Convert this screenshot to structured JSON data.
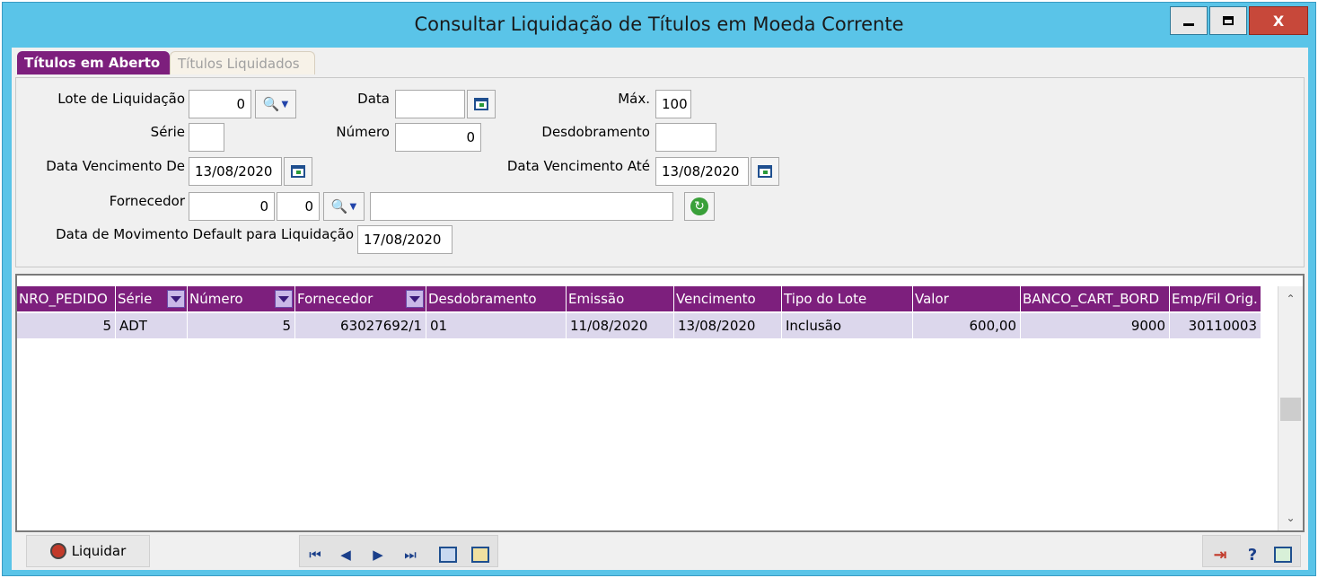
{
  "window": {
    "title": "Consultar Liquidação de Títulos em Moeda Corrente",
    "minimize_icon": "minimize-icon",
    "maximize_icon": "maximize-icon",
    "close_label": "X"
  },
  "tabs": [
    {
      "label": "Títulos em Aberto",
      "active": true
    },
    {
      "label": "Títulos Liquidados",
      "active": false
    }
  ],
  "form": {
    "lote_label": "Lote de Liquidação",
    "lote_value": "0",
    "data_label": "Data",
    "data_value": "",
    "max_label": "Máx.",
    "max_value": "100",
    "serie_label": "Série",
    "serie_value": "",
    "numero_label": "Número",
    "numero_value": "0",
    "desdobramento_label": "Desdobramento",
    "desdobramento_value": "",
    "venc_de_label": "Data Vencimento De",
    "venc_de_value": "13/08/2020",
    "venc_ate_label": "Data Vencimento  Até",
    "venc_ate_value": "13/08/2020",
    "fornecedor_label": "Fornecedor",
    "fornecedor_code1": "0",
    "fornecedor_code2": "0",
    "fornecedor_name": "",
    "mov_default_label": "Data de Movimento Default para Liquidação",
    "mov_default_value": "17/08/2020"
  },
  "grid": {
    "columns": [
      {
        "label": "NRO_PEDIDO",
        "dropdown": false
      },
      {
        "label": "Série",
        "dropdown": true
      },
      {
        "label": "Número",
        "dropdown": true
      },
      {
        "label": "Fornecedor",
        "dropdown": true
      },
      {
        "label": "Desdobramento",
        "dropdown": false
      },
      {
        "label": "Emissão",
        "dropdown": false
      },
      {
        "label": "Vencimento",
        "dropdown": false
      },
      {
        "label": "Tipo do Lote",
        "dropdown": false
      },
      {
        "label": "Valor",
        "dropdown": false
      },
      {
        "label": "BANCO_CART_BORD",
        "dropdown": false
      },
      {
        "label": "Emp/Fil Orig.",
        "dropdown": false
      }
    ],
    "rows": [
      [
        "5",
        "ADT",
        "5",
        "63027692/1",
        "01",
        "11/08/2020",
        "13/08/2020",
        "Inclusão",
        "600,00",
        "9000",
        "30110003"
      ]
    ]
  },
  "toolbar": {
    "liquidar_label": "Liquidar",
    "nav_first": "⏮",
    "nav_prev": "◀",
    "nav_next": "▶",
    "nav_last": "⏭",
    "help_label": "?"
  },
  "colors": {
    "accent": "#7d1f7d",
    "titlebar": "#5ac4e8",
    "row_selected": "#dcd7ec"
  }
}
